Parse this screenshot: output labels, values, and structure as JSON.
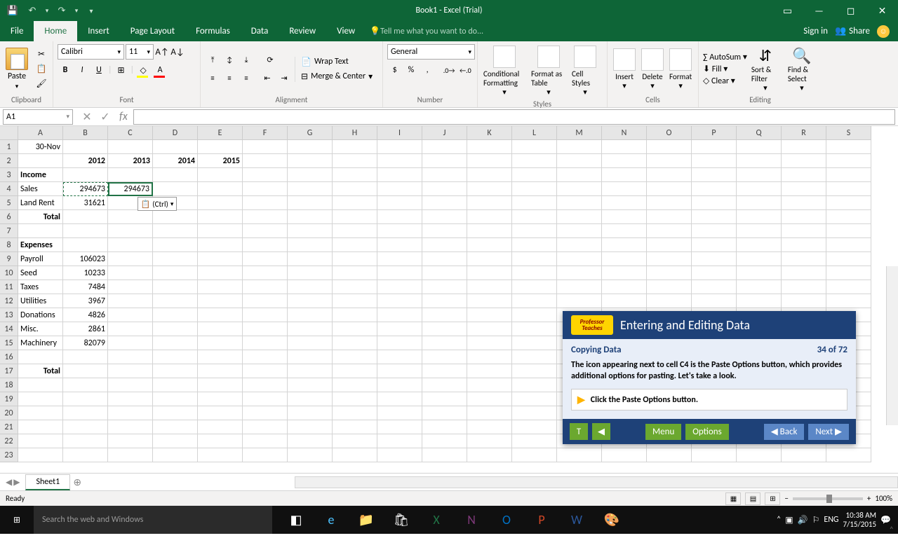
{
  "titlebar": {
    "title": "Book1 - Excel (Trial)"
  },
  "menu": {
    "file": "File",
    "home": "Home",
    "insert": "Insert",
    "pagelayout": "Page Layout",
    "formulas": "Formulas",
    "data": "Data",
    "review": "Review",
    "view": "View",
    "tellme": "Tell me what you want to do...",
    "signin": "Sign in",
    "share": "Share"
  },
  "ribbon": {
    "clipboard": {
      "label": "Clipboard",
      "paste": "Paste"
    },
    "font": {
      "label": "Font",
      "name": "Calibri",
      "size": "11"
    },
    "alignment": {
      "label": "Alignment",
      "wrap": "Wrap Text",
      "merge": "Merge & Center"
    },
    "number": {
      "label": "Number",
      "format": "General"
    },
    "styles": {
      "label": "Styles",
      "cond": "Conditional Formatting",
      "table": "Format as Table",
      "cell": "Cell Styles"
    },
    "cells": {
      "label": "Cells",
      "insert": "Insert",
      "delete": "Delete",
      "format": "Format"
    },
    "editing": {
      "label": "Editing",
      "autosum": "AutoSum",
      "fill": "Fill",
      "clear": "Clear",
      "sort": "Sort & Filter",
      "find": "Find & Select"
    }
  },
  "namebox": "A1",
  "columns": [
    "A",
    "B",
    "C",
    "D",
    "E",
    "F",
    "G",
    "H",
    "I",
    "J",
    "K",
    "L",
    "M",
    "N",
    "O",
    "P",
    "Q",
    "R",
    "S"
  ],
  "rows": [
    "1",
    "2",
    "3",
    "4",
    "5",
    "6",
    "7",
    "8",
    "9",
    "10",
    "11",
    "12",
    "13",
    "14",
    "15",
    "16",
    "17",
    "18",
    "19",
    "20",
    "21",
    "22",
    "23"
  ],
  "data": {
    "A1": "30-Nov",
    "B2": "2012",
    "C2": "2013",
    "D2": "2014",
    "E2": "2015",
    "A3": "Income",
    "A4": "Sales",
    "B4": "294673",
    "C4": "294673",
    "A5": "Land Rent",
    "B5": "31621",
    "A6": "Total",
    "A8": "Expenses",
    "A9": "Payroll",
    "B9": "106023",
    "A10": "Seed",
    "B10": "10233",
    "A11": "Taxes",
    "B11": "7484",
    "A12": "Utilities",
    "B12": "3967",
    "A13": "Donations",
    "B13": "4826",
    "A14": "Misc.",
    "B14": "2861",
    "A15": "Machinery",
    "B15": "82079",
    "A17": "Total"
  },
  "paste_options": "(Ctrl)",
  "sheet": {
    "name": "Sheet1"
  },
  "status": {
    "ready": "Ready",
    "zoom": "100%"
  },
  "tutor": {
    "brand": "Professor Teaches",
    "title": "Entering and Editing Data",
    "subtitle": "Copying Data",
    "progress": "34 of 72",
    "text": "The icon appearing next to cell C4 is the Paste Options button, which provides additional options for pasting. Let's take a look.",
    "action": "Click the Paste Options button.",
    "menu": "Menu",
    "options": "Options",
    "back": "Back",
    "next": "Next"
  },
  "taskbar": {
    "search": "Search the web and Windows",
    "lang": "ENG",
    "time": "10:38 AM",
    "date": "7/15/2015"
  }
}
